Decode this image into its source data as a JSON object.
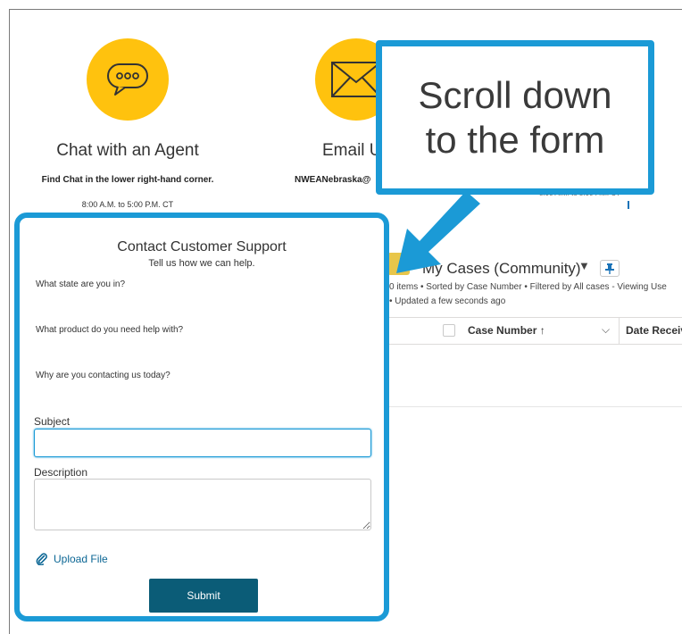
{
  "page": {
    "chat_title": "Chat with an Agent",
    "chat_note": "Find Chat in the lower right-hand corner.",
    "chat_hours": "8:00 A.M. to 5:00 P.M. CT",
    "email_title": "Email U",
    "email_address": "NWEANebraska@",
    "right_hours": "8:00 A.M. to 5:00 P.M. CT"
  },
  "callout": {
    "line1": "Scroll down",
    "line2": "to the form"
  },
  "cases": {
    "title": "My Cases (Community)",
    "meta_line1": "0 items • Sorted by Case Number • Filtered by All cases - Viewing Use",
    "meta_line2": "• Updated a few seconds ago",
    "col_case_number": "Case Number ↑",
    "col_date": "Date Receiv"
  },
  "form": {
    "title": "Contact Customer Support",
    "subtitle": "Tell us how we can help.",
    "q_state": "What state are you in?",
    "q_product": "What product do you need help with?",
    "q_reason": "Why are you contacting us today?",
    "subject_label": "Subject",
    "subject_value": "",
    "description_label": "Description",
    "description_value": "",
    "upload_label": "Upload File",
    "submit_label": "Submit"
  },
  "colors": {
    "accent_blue": "#1b9ad6",
    "icon_yellow": "#ffc20e",
    "submit_bg": "#0b5c77",
    "link_blue": "#0b6694"
  },
  "icons": [
    "chat-bubble-icon",
    "envelope-icon",
    "briefcase-icon",
    "pin-icon",
    "paperclip-icon",
    "caret-down-icon",
    "chevron-down-icon"
  ]
}
